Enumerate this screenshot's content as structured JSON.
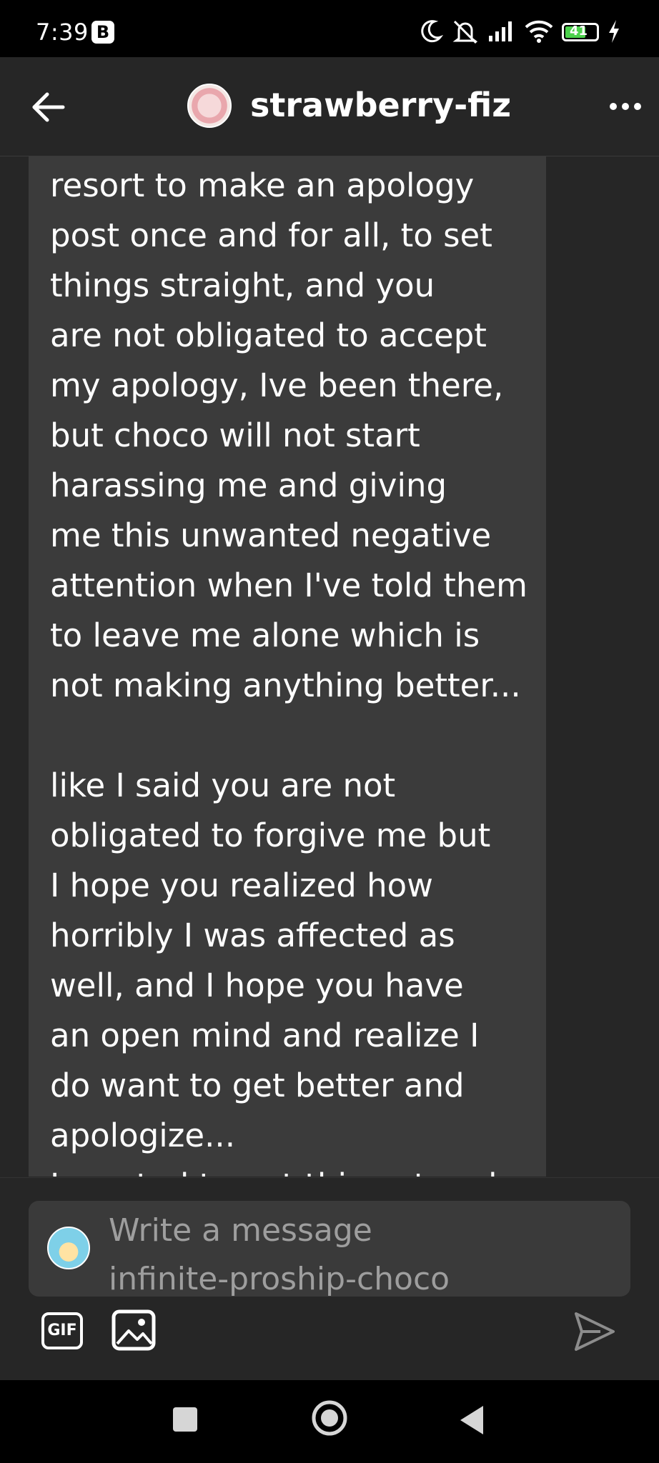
{
  "status_bar": {
    "time": "7:39",
    "badge": "B",
    "battery": "41"
  },
  "header": {
    "blog_name": "strawberry-fiz",
    "back_icon": "arrow-left-icon",
    "more_icon": "more-horizontal-icon"
  },
  "message": {
    "text": "resort to make an apology\npost once and for all, to set\nthings straight, and you\nare not obligated to accept\nmy apology, Ive been there,\nbut choco will not start\nharassing me and giving\nme this unwanted negative\nattention when I've told them\nto leave me alone which is\nnot making anything better...\n\nlike I said you are not\nobligated to forgive me but\nI hope you realized how\nhorribly I was affected as\nwell, and I hope you have\nan open mind and realize I\ndo want to get better and\napologize...\nI wanted to get this out and"
  },
  "composer": {
    "placeholder_line1": "Write a message",
    "placeholder_line2": "infinite-proship-choco",
    "gif_label": "GIF"
  },
  "colors": {
    "background": "#262626",
    "bubble": "#3b3b3b",
    "placeholder": "#9e9e9e",
    "status_bar": "#000000"
  }
}
